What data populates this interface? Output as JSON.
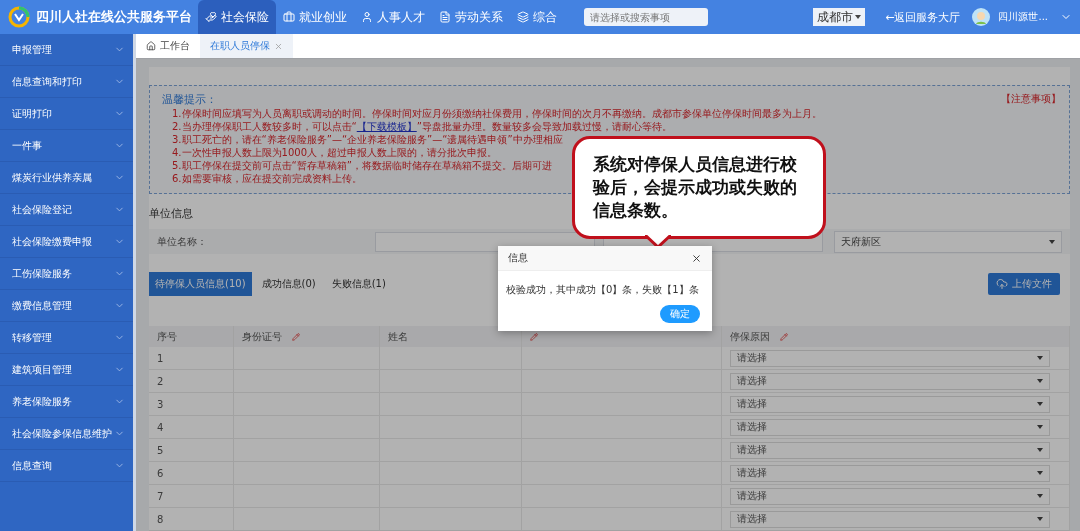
{
  "header": {
    "title": "四川人社在线公共服务平台",
    "nav": [
      {
        "label": "社会保险",
        "selected": true
      },
      {
        "label": "就业创业",
        "selected": false
      },
      {
        "label": "人事人才",
        "selected": false
      },
      {
        "label": "劳动关系",
        "selected": false
      },
      {
        "label": "综合",
        "selected": false
      }
    ],
    "search": {
      "placeholder": "请选择或搜索事项"
    },
    "city": "成都市",
    "back_link": "←返回服务大厅",
    "user": "四川源世..."
  },
  "sidebar": {
    "items": [
      {
        "label": "申报管理"
      },
      {
        "label": "信息查询和打印"
      },
      {
        "label": "证明打印"
      },
      {
        "label": "一件事"
      },
      {
        "label": "煤炭行业供养亲属"
      },
      {
        "label": "社会保险登记"
      },
      {
        "label": "社会保险缴费申报"
      },
      {
        "label": "工伤保险服务"
      },
      {
        "label": "缴费信息管理"
      },
      {
        "label": "转移管理"
      },
      {
        "label": "建筑项目管理"
      },
      {
        "label": "养老保险服务"
      },
      {
        "label": "社会保险参保信息维护"
      },
      {
        "label": "信息查询"
      }
    ]
  },
  "page_tabs": [
    {
      "label": "工作台",
      "kind": "home",
      "selected": false
    },
    {
      "label": "在职人员停保",
      "kind": "closable",
      "selected": true
    }
  ],
  "notice": {
    "title": "温馨提示：",
    "notes_link": "【注意事项】",
    "lines": [
      {
        "kind": "plain",
        "text": "1.停保时间应填写为人员离职或调动的时间。停保时间对应月份须缴纳社保费用，停保时间的次月不再缴纳。成都市参保单位停保时间最多为上月。"
      },
      {
        "kind": "link",
        "before": "2.当办理停保职工人数较多时，可以点击“",
        "link": "【下载模板】",
        "after": "”导盘批量办理。数量较多会导致加载过慢，请耐心等待。"
      },
      {
        "kind": "plain",
        "text": "3.职工死亡的，请在“养老保险服务”—“企业养老保险服务”—“遗属待遇申领”中办理相应"
      },
      {
        "kind": "plain",
        "text": "4.一次性申报人数上限为1000人，超过申报人数上限的，请分批次申报。"
      },
      {
        "kind": "plain",
        "text": "5.职工停保在提交前可点击“暂存草稿箱”，将数据临时储存在草稿箱不提交。后期可进"
      },
      {
        "kind": "plain",
        "text": "6.如需要审核，应在提交前完成资料上传。"
      }
    ]
  },
  "callout": "系统对停保人员信息进行校验后，会提示成功或失败的信息条数。",
  "unit_info": {
    "title": "单位信息",
    "name_label": "单位名称：",
    "district": "天府新区"
  },
  "record_tabs": [
    {
      "label": "待停保人员信息(10)",
      "selected": true
    },
    {
      "label": "成功信息(0)",
      "selected": false
    },
    {
      "label": "失败信息(1)",
      "selected": false
    }
  ],
  "upload_button": "上传文件",
  "table": {
    "columns": [
      {
        "label": "序号",
        "required": false
      },
      {
        "label": "身份证号",
        "required": true
      },
      {
        "label": "姓名",
        "required": false
      },
      {
        "required": true
      },
      {
        "label": "停保原因",
        "required": true
      }
    ],
    "rows": [
      {
        "index": "1",
        "reason": "请选择"
      },
      {
        "index": "2",
        "reason": "请选择"
      },
      {
        "index": "3",
        "reason": "请选择"
      },
      {
        "index": "4",
        "reason": "请选择"
      },
      {
        "index": "5",
        "reason": "请选择"
      },
      {
        "index": "6",
        "reason": "请选择"
      },
      {
        "index": "7",
        "reason": "请选择"
      },
      {
        "index": "8",
        "reason": "请选择"
      }
    ]
  },
  "dialog": {
    "title": "信息",
    "message": "校验成功，其中成功【0】条，失败【1】条",
    "confirm": "确定"
  }
}
